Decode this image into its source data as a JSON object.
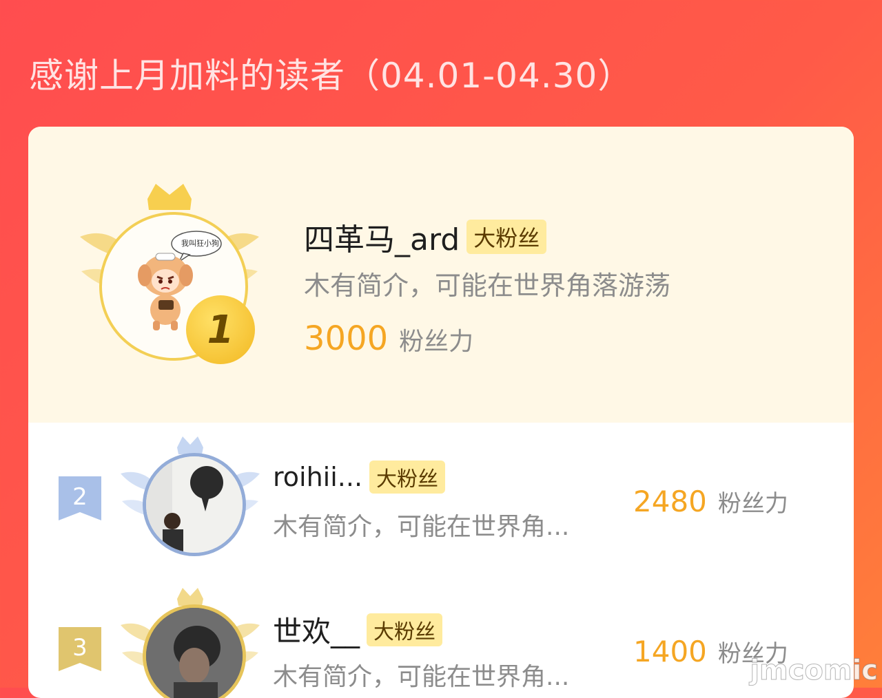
{
  "header": {
    "title": "感谢上月加料的读者（04.01-04.30）"
  },
  "colors": {
    "accent": "#ff4d4f",
    "gold": "#f5a623",
    "badge_bg": "#ffeb9e",
    "silver": "#9db5e0",
    "bronze": "#e8c97a"
  },
  "ranking": [
    {
      "rank": "1",
      "name": "四革马_ard",
      "badge": "大粉丝",
      "bio": "木有简介，可能在世界角落游荡",
      "score": "3000",
      "score_label": "粉丝力",
      "avatar_icon": "cartoon-dog-avatar",
      "avatar_speech_text": "我叫狂小狗"
    },
    {
      "rank": "2",
      "name": "roihii...",
      "badge": "大粉丝",
      "bio": "木有简介，可能在世界角...",
      "score": "2480",
      "score_label": "粉丝力",
      "avatar_icon": "photo-avatar"
    },
    {
      "rank": "3",
      "name": "世欢__",
      "badge": "大粉丝",
      "bio": "木有简介，可能在世界角...",
      "score": "1400",
      "score_label": "粉丝力",
      "avatar_icon": "photo-avatar"
    }
  ],
  "watermark": "jmcomic"
}
